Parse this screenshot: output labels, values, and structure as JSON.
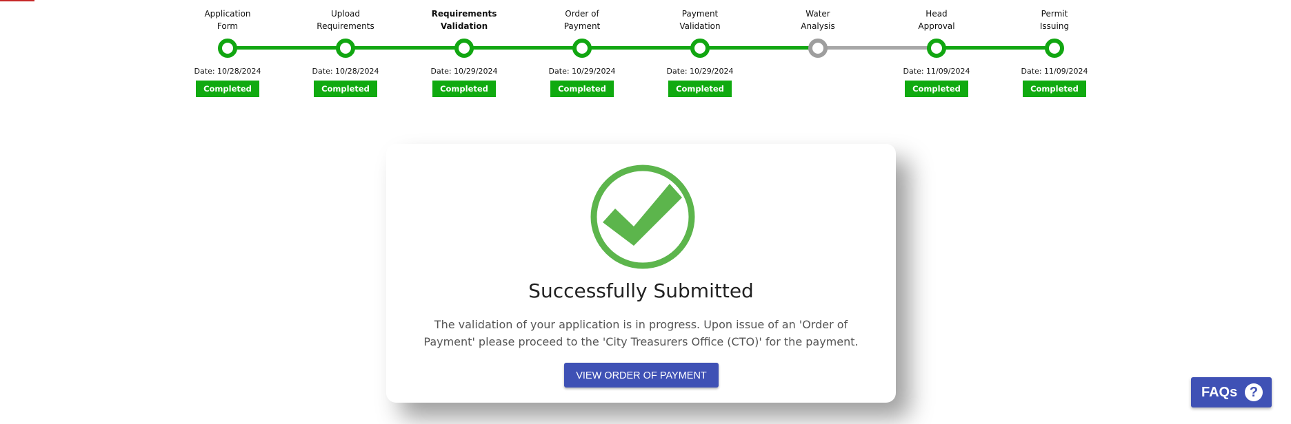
{
  "stepper": {
    "steps": [
      {
        "label": "Application\nForm",
        "date": "Date: 10/28/2024",
        "status": "Completed",
        "state": "done"
      },
      {
        "label": "Upload\nRequirements",
        "date": "Date: 10/28/2024",
        "status": "Completed",
        "state": "done"
      },
      {
        "label": "Requirements\nValidation",
        "date": "Date: 10/29/2024",
        "status": "Completed",
        "state": "done",
        "current": true
      },
      {
        "label": "Order of\nPayment",
        "date": "Date: 10/29/2024",
        "status": "Completed",
        "state": "done"
      },
      {
        "label": "Payment\nValidation",
        "date": "Date: 10/29/2024",
        "status": "Completed",
        "state": "done"
      },
      {
        "label": "Water\nAnalysis",
        "date": "",
        "status": "",
        "state": "pending"
      },
      {
        "label": "Head\nApproval",
        "date": "Date: 11/09/2024",
        "status": "Completed",
        "state": "done"
      },
      {
        "label": "Permit\nIssuing",
        "date": "Date: 11/09/2024",
        "status": "Completed",
        "state": "done"
      }
    ]
  },
  "card": {
    "title": "Successfully Submitted",
    "message": "The validation of your application is in progress. Upon issue of an 'Order of Payment' please proceed to the 'City Treasurers Office (CTO)' for the payment.",
    "button_label": "VIEW ORDER OF PAYMENT",
    "icon": "check-circle-icon"
  },
  "faq": {
    "label": "FAQs",
    "icon": "question-circle-icon"
  },
  "colors": {
    "done": "#11a611",
    "pending": "#9e9e9e",
    "success_icon": "#5cb54c",
    "primary": "#3f51b5",
    "accent": "#c62828"
  }
}
